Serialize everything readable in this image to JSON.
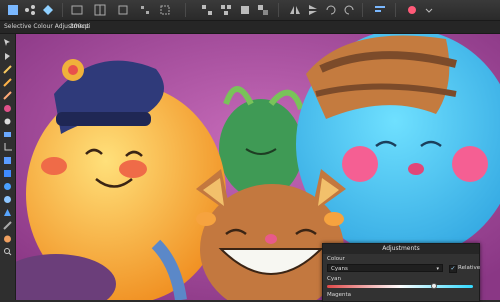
{
  "context_bar": {
    "tool_name": "Selective Colour Adjustment",
    "zoom": "300cpi"
  },
  "toolbar": {
    "icons": [
      "persona-icon",
      "share-icon",
      "pixel-persona-icon",
      "view-mode-icon",
      "gridlines-icon",
      "snap-icon",
      "align-icon",
      "arrange-icon",
      "flip-icon",
      "transform-icon",
      "order-icon",
      "brush-icon"
    ]
  },
  "adjustments_panel": {
    "title": "Adjustments",
    "colour_label": "Colour",
    "colour_value": "Cyans",
    "relative_label": "Relative",
    "relative_checked": true,
    "cyan_label": "Cyan",
    "cyan_value_fraction": 0.73,
    "magenta_label": "Magenta"
  },
  "colors": {
    "background": "#a0459a",
    "orange_character": "#f0b03c",
    "blue_character": "#46c9f2",
    "cat_character": "#c3783f"
  }
}
